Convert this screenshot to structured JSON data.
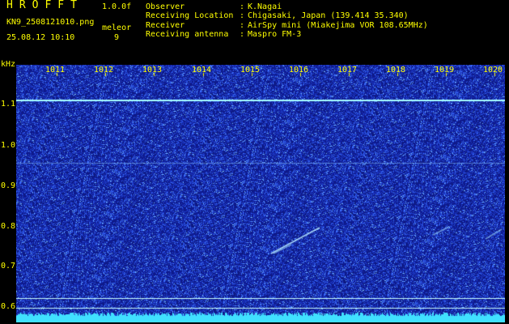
{
  "header": {
    "app_title": "HROFFT",
    "version": "1.0.0f",
    "file_name": "KN9_2508121010.png",
    "capture_time": "25.08.12 10:10",
    "meteor_label": "meleor",
    "meteor_count": "9",
    "meta": [
      {
        "key": "Observer",
        "value": "K.Nagai"
      },
      {
        "key": "Receiving Location",
        "value": "Chigasaki, Japan (139.414 35.340)"
      },
      {
        "key": "Receiver",
        "value": "AirSpy mini (Miakejima VOR 108.65MHz)"
      },
      {
        "key": "Receiving antenna",
        "value": "Maspro FM-3"
      }
    ]
  },
  "spectrogram": {
    "unit": "kHz",
    "x_ticks": [
      "1011",
      "1012",
      "1013",
      "1014",
      "1015",
      "1016",
      "1017",
      "1018",
      "1019",
      "1020"
    ],
    "y_ticks": [
      "1.1",
      "1.0",
      "0.9",
      "0.8",
      "0.7",
      "0.6"
    ],
    "background_color": "#101c8c",
    "noise_color": "#3050ff",
    "line_color": "#c8ffff",
    "bottom_band_color": "#40e0ff"
  }
}
